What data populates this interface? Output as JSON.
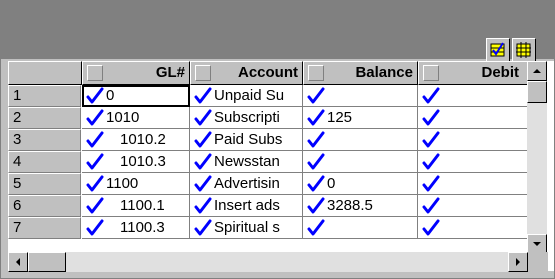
{
  "toolbar": {
    "buttons": [
      {
        "icon": "select-all-icon"
      },
      {
        "icon": "grid-icon"
      }
    ]
  },
  "grid": {
    "columns": [
      "GL#",
      "Account",
      "Balance",
      "Debit"
    ],
    "rows": [
      {
        "num": "1",
        "gl": "0",
        "account": "Unpaid Su",
        "balance": "",
        "debit": ""
      },
      {
        "num": "2",
        "gl": "1010",
        "account": "Subscripti",
        "balance": "125",
        "debit": ""
      },
      {
        "num": "3",
        "gl": "1010.2",
        "account": "Paid Subs",
        "balance": "",
        "debit": ""
      },
      {
        "num": "4",
        "gl": "1010.3",
        "account": "Newsstan",
        "balance": "",
        "debit": ""
      },
      {
        "num": "5",
        "gl": "1100",
        "account": "Advertisin",
        "balance": "0",
        "debit": ""
      },
      {
        "num": "6",
        "gl": "1100.1",
        "account": "Insert ads",
        "balance": "3288.5",
        "debit": ""
      },
      {
        "num": "7",
        "gl": "1100.3",
        "account": "Spiritual s",
        "balance": "",
        "debit": ""
      }
    ]
  },
  "colors": {
    "check": "#0000ff",
    "chrome": "#c0c0c0",
    "dark": "#808080"
  }
}
